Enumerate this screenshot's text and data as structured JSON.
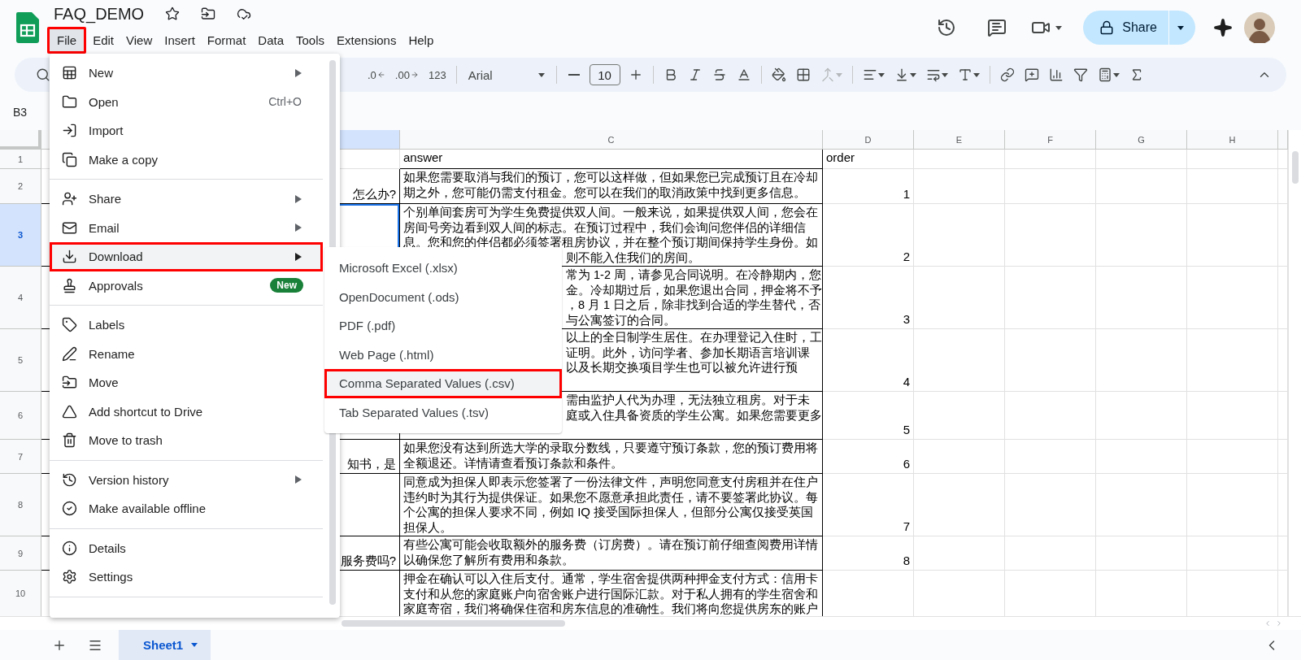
{
  "document": {
    "title": "FAQ_DEMO"
  },
  "menu_bar": [
    {
      "label": "File",
      "selected": true,
      "annotated": true
    },
    {
      "label": "Edit",
      "selected": false,
      "annotated": false
    },
    {
      "label": "View",
      "selected": false,
      "annotated": false
    },
    {
      "label": "Insert",
      "selected": false,
      "annotated": false
    },
    {
      "label": "Format",
      "selected": false,
      "annotated": false
    },
    {
      "label": "Data",
      "selected": false,
      "annotated": false
    },
    {
      "label": "Tools",
      "selected": false,
      "annotated": false
    },
    {
      "label": "Extensions",
      "selected": false,
      "annotated": false
    },
    {
      "label": "Help",
      "selected": false,
      "annotated": false
    }
  ],
  "share_button": {
    "label": "Share"
  },
  "toolbar": {
    "decrease_decimal": ".0",
    "increase_decimal": ".00",
    "number_format": "123",
    "font": "Arial",
    "font_size": "10",
    "merge_cells": {
      "disabled": true
    }
  },
  "name_box": "B3",
  "columns": [
    {
      "selected": false
    },
    {
      "selected": true
    },
    {
      "label": "C",
      "selected": false
    },
    {
      "label": "D",
      "selected": false
    },
    {
      "label": "E",
      "selected": false
    },
    {
      "label": "F",
      "selected": false
    },
    {
      "label": "G",
      "selected": false
    },
    {
      "label": "H",
      "selected": false
    }
  ],
  "rows": [
    {
      "number": "1",
      "selected": false,
      "c": {
        "text": "answer"
      },
      "d": {
        "text": "order",
        "kind": "text"
      }
    },
    {
      "number": "2",
      "selected": false,
      "b": {
        "fragments": [
          "怎么办?"
        ]
      },
      "c": {
        "text": "如果您需要取消与我们的预订，您可以这样做，但如果您已完成预订且在冷却期之外，您可能仍需支付租金。您可以在我们的取消政策中找到更多信息。"
      },
      "d": {
        "text": "1",
        "kind": "number"
      }
    },
    {
      "number": "3",
      "selected": true,
      "c": {
        "text": "个别单间套房可为学生免费提供双人间。一般来说，如果提供双人间，您会在房间号旁边看到双人间的标志。在预订过程中，我们会询问您伴侣的详细信息。您和您的伴侣都必须签署租房协议，并在整个预订期间保持学生身份。如",
        "fragments": [
          "则不能入住我们的房间。"
        ]
      },
      "d": {
        "text": "2",
        "kind": "number"
      }
    },
    {
      "number": "4",
      "selected": false,
      "c": {
        "fragments": [
          "常为 1-2 周，请参见合同说明。在冷静期内，您",
          "金。冷却期过后，如果您退出合同，押金将不予",
          "，8 月 1 日之后，除非找到合适的学生替代，否",
          "与公寓签订的合同。"
        ]
      },
      "d": {
        "text": "3",
        "kind": "number"
      }
    },
    {
      "number": "5",
      "selected": false,
      "c": {
        "fragments": [
          "以上的全日制学生居住。在办理登记入住时，工",
          "证明。此外，访问学者、参加长期语言培训课",
          "以及长期交换项目学生也可以被允许进行预"
        ]
      },
      "d": {
        "text": "4",
        "kind": "number"
      }
    },
    {
      "number": "6",
      "selected": false,
      "c": {
        "fragments": [
          "需由监护人代为办理，无法独立租房。对于未",
          "庭或入住具备资质的学生公寓。如果您需要更多"
        ]
      },
      "d": {
        "text": "5",
        "kind": "number"
      }
    },
    {
      "number": "7",
      "selected": false,
      "b": {
        "fragments": [
          "知书，是"
        ]
      },
      "c": {
        "text": "如果您没有达到所选大学的录取分数线，只要遵守预订条款，您的预订费用将全额退还。详情请查看预订条款和条件。"
      },
      "d": {
        "text": "6",
        "kind": "number"
      }
    },
    {
      "number": "8",
      "selected": false,
      "c": {
        "text": "同意成为担保人即表示您签署了一份法律文件，声明您同意支付房租并在住户违约时为其行为提供保证。如果您不愿意承担此责任，请不要签署此协议。每个公寓的担保人要求不同，例如 IQ 接受国际担保人，但部分公寓仅接受英国担保人。"
      },
      "d": {
        "text": "7",
        "kind": "number"
      }
    },
    {
      "number": "9",
      "selected": false,
      "b": {
        "fragments": [
          "服务费吗?"
        ]
      },
      "c": {
        "text": "有些公寓可能会收取额外的服务费（订房费）。请在预订前仔细查阅费用详情以确保您了解所有费用和条款。"
      },
      "d": {
        "text": "8",
        "kind": "number"
      }
    },
    {
      "number": "10",
      "selected": false,
      "c": {
        "text": "押金在确认可以入住后支付。通常，学生宿舍提供两种押金支付方式：信用卡支付和从您的家庭账户向宿舍账户进行国际汇款。对于私人拥有的学生宿舍和家庭寄宿，我们将确保住宿和房东信息的准确性。我们将向您提供房东的账户"
      }
    }
  ],
  "file_menu": {
    "groups": [
      [
        {
          "label": "New",
          "submenu": true,
          "highlighted": false,
          "annotated": false
        },
        {
          "label": "Open",
          "shortcut": "Ctrl+O",
          "submenu": false,
          "highlighted": false,
          "annotated": false
        },
        {
          "label": "Import",
          "submenu": false,
          "highlighted": false,
          "annotated": false
        },
        {
          "label": "Make a copy",
          "submenu": false,
          "highlighted": false,
          "annotated": false
        }
      ],
      [
        {
          "label": "Share",
          "submenu": true,
          "highlighted": false,
          "annotated": false
        },
        {
          "label": "Email",
          "submenu": true,
          "highlighted": false,
          "annotated": false
        },
        {
          "label": "Download",
          "submenu": true,
          "highlighted": true,
          "annotated": true
        },
        {
          "label": "Approvals",
          "badge": "New",
          "submenu": false,
          "highlighted": false,
          "annotated": false
        }
      ],
      [
        {
          "label": "Labels",
          "submenu": false,
          "highlighted": false,
          "annotated": false
        },
        {
          "label": "Rename",
          "submenu": false,
          "highlighted": false,
          "annotated": false
        },
        {
          "label": "Move",
          "submenu": false,
          "highlighted": false,
          "annotated": false
        },
        {
          "label": "Add shortcut to Drive",
          "submenu": false,
          "highlighted": false,
          "annotated": false
        },
        {
          "label": "Move to trash",
          "submenu": false,
          "highlighted": false,
          "annotated": false
        }
      ],
      [
        {
          "label": "Version history",
          "submenu": true,
          "highlighted": false,
          "annotated": false
        },
        {
          "label": "Make available offline",
          "submenu": false,
          "highlighted": false,
          "annotated": false
        }
      ],
      [
        {
          "label": "Details",
          "submenu": false,
          "highlighted": false,
          "annotated": false
        },
        {
          "label": "Settings",
          "submenu": false,
          "highlighted": false,
          "annotated": false
        }
      ]
    ]
  },
  "download_submenu": [
    {
      "label": "Microsoft Excel (.xlsx)",
      "highlighted": false,
      "annotated": false
    },
    {
      "label": "OpenDocument (.ods)",
      "highlighted": false,
      "annotated": false
    },
    {
      "label": "PDF (.pdf)",
      "highlighted": false,
      "annotated": false
    },
    {
      "label": "Web Page (.html)",
      "highlighted": false,
      "annotated": false
    },
    {
      "label": "Comma Separated Values (.csv)",
      "highlighted": true,
      "annotated": true
    },
    {
      "label": "Tab Separated Values (.tsv)",
      "highlighted": false,
      "annotated": false
    }
  ],
  "sheet_tabs": [
    {
      "label": "Sheet1",
      "selected": true
    }
  ]
}
